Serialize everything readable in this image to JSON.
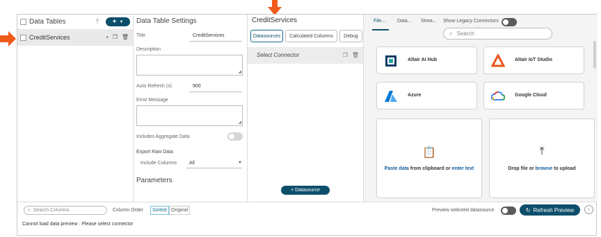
{
  "tables_panel": {
    "title": "Data Tables",
    "upload_icon": "upload-icon",
    "add_glyph": "+",
    "items": [
      {
        "label": "CreditServices",
        "selected": true
      }
    ]
  },
  "settings": {
    "title": "Data Table Settings",
    "title_label": "Title",
    "title_value": "CreditServices",
    "description_label": "Description",
    "auto_refresh_label": "Auto Refresh (s)",
    "auto_refresh_value": "900",
    "error_label": "Error Message",
    "aggregate_label": "Includes Aggregate Data",
    "export_label": "Export Raw Data",
    "include_columns_label": "Include Columns",
    "include_columns_value": "All",
    "parameters_title": "Parameters"
  },
  "datasource_panel": {
    "title": "CreditServices",
    "tabs": [
      "Datasources",
      "Calculated Columns",
      "Debug"
    ],
    "active_tab": "Datasources",
    "connector_label": "Select Connector",
    "add_button": "+ Datasource"
  },
  "connectors_panel": {
    "tabs": [
      "File...",
      "Data...",
      "Strea..."
    ],
    "active_tab": "File...",
    "legacy_label": "Show Legacy Connectors",
    "search_placeholder": "Search",
    "cards": [
      {
        "name": "Altair AI Hub",
        "icon": "altair-ai-hub-icon",
        "color": "#0d3b66"
      },
      {
        "name": "Altair IoT Studio",
        "icon": "altair-iot-icon",
        "color": "#e8541e"
      },
      {
        "name": "Azure",
        "icon": "azure-icon",
        "color": "#0078d4"
      },
      {
        "name": "Google Cloud",
        "icon": "google-cloud-icon",
        "color": "#4285f4"
      }
    ],
    "paste_a": "Paste data",
    "paste_b": " from clipboard or ",
    "paste_c": "enter text",
    "drop_a": "Drop file or ",
    "drop_b": "browse",
    "drop_c": " to upload"
  },
  "bottom_bar": {
    "search_placeholder": "Search Columns",
    "column_order_label": "Column Order",
    "sorted_label": "Sorted",
    "original_label": "Original",
    "preview_label": "Preview selected datasource",
    "refresh_label": "Refresh Preview",
    "message": "Cannot load data preview : Please select connector"
  },
  "colors": {
    "accent": "#0d4f6b",
    "arrow": "#f05a1a"
  }
}
